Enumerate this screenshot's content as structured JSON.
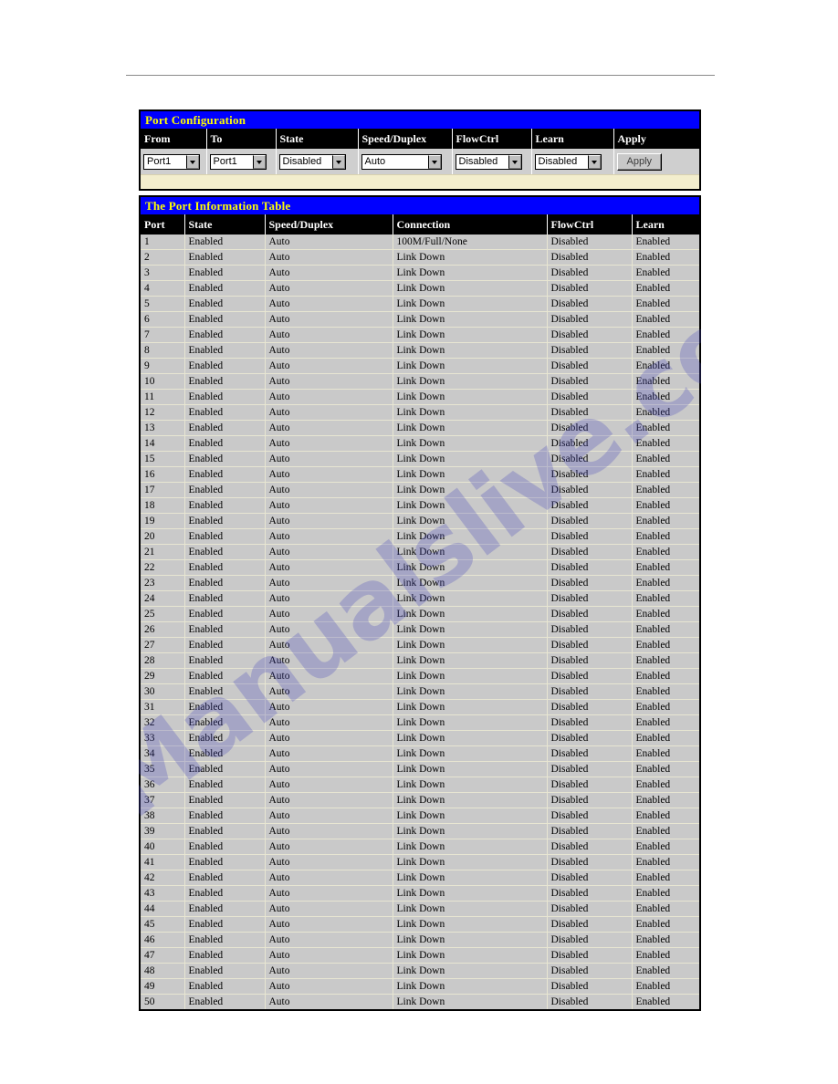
{
  "page": {
    "rule": "horizontal-rule"
  },
  "watermark": {
    "text": "Manualslive.com"
  },
  "port_configuration": {
    "title": "Port Configuration",
    "headers": [
      "From",
      "To",
      "State",
      "Speed/Duplex",
      "FlowCtrl",
      "Learn",
      "Apply"
    ],
    "fields": {
      "from": {
        "label": "From",
        "value": "Port1"
      },
      "to": {
        "label": "To",
        "value": "Port1"
      },
      "state": {
        "label": "State",
        "value": "Disabled"
      },
      "speed_duplex": {
        "label": "Speed/Duplex",
        "value": "Auto"
      },
      "flowctrl": {
        "label": "FlowCtrl",
        "value": "Disabled"
      },
      "learn": {
        "label": "Learn",
        "value": "Disabled"
      }
    },
    "apply_label": "Apply"
  },
  "port_information_table": {
    "title": "The Port Information Table",
    "headers": [
      "Port",
      "State",
      "Speed/Duplex",
      "Connection",
      "FlowCtrl",
      "Learn"
    ],
    "rows": [
      [
        "1",
        "Enabled",
        "Auto",
        "100M/Full/None",
        "Disabled",
        "Enabled"
      ],
      [
        "2",
        "Enabled",
        "Auto",
        "Link Down",
        "Disabled",
        "Enabled"
      ],
      [
        "3",
        "Enabled",
        "Auto",
        "Link Down",
        "Disabled",
        "Enabled"
      ],
      [
        "4",
        "Enabled",
        "Auto",
        "Link Down",
        "Disabled",
        "Enabled"
      ],
      [
        "5",
        "Enabled",
        "Auto",
        "Link Down",
        "Disabled",
        "Enabled"
      ],
      [
        "6",
        "Enabled",
        "Auto",
        "Link Down",
        "Disabled",
        "Enabled"
      ],
      [
        "7",
        "Enabled",
        "Auto",
        "Link Down",
        "Disabled",
        "Enabled"
      ],
      [
        "8",
        "Enabled",
        "Auto",
        "Link Down",
        "Disabled",
        "Enabled"
      ],
      [
        "9",
        "Enabled",
        "Auto",
        "Link Down",
        "Disabled",
        "Enabled"
      ],
      [
        "10",
        "Enabled",
        "Auto",
        "Link Down",
        "Disabled",
        "Enabled"
      ],
      [
        "11",
        "Enabled",
        "Auto",
        "Link Down",
        "Disabled",
        "Enabled"
      ],
      [
        "12",
        "Enabled",
        "Auto",
        "Link Down",
        "Disabled",
        "Enabled"
      ],
      [
        "13",
        "Enabled",
        "Auto",
        "Link Down",
        "Disabled",
        "Enabled"
      ],
      [
        "14",
        "Enabled",
        "Auto",
        "Link Down",
        "Disabled",
        "Enabled"
      ],
      [
        "15",
        "Enabled",
        "Auto",
        "Link Down",
        "Disabled",
        "Enabled"
      ],
      [
        "16",
        "Enabled",
        "Auto",
        "Link Down",
        "Disabled",
        "Enabled"
      ],
      [
        "17",
        "Enabled",
        "Auto",
        "Link Down",
        "Disabled",
        "Enabled"
      ],
      [
        "18",
        "Enabled",
        "Auto",
        "Link Down",
        "Disabled",
        "Enabled"
      ],
      [
        "19",
        "Enabled",
        "Auto",
        "Link Down",
        "Disabled",
        "Enabled"
      ],
      [
        "20",
        "Enabled",
        "Auto",
        "Link Down",
        "Disabled",
        "Enabled"
      ],
      [
        "21",
        "Enabled",
        "Auto",
        "Link Down",
        "Disabled",
        "Enabled"
      ],
      [
        "22",
        "Enabled",
        "Auto",
        "Link Down",
        "Disabled",
        "Enabled"
      ],
      [
        "23",
        "Enabled",
        "Auto",
        "Link Down",
        "Disabled",
        "Enabled"
      ],
      [
        "24",
        "Enabled",
        "Auto",
        "Link Down",
        "Disabled",
        "Enabled"
      ],
      [
        "25",
        "Enabled",
        "Auto",
        "Link Down",
        "Disabled",
        "Enabled"
      ],
      [
        "26",
        "Enabled",
        "Auto",
        "Link Down",
        "Disabled",
        "Enabled"
      ],
      [
        "27",
        "Enabled",
        "Auto",
        "Link Down",
        "Disabled",
        "Enabled"
      ],
      [
        "28",
        "Enabled",
        "Auto",
        "Link Down",
        "Disabled",
        "Enabled"
      ],
      [
        "29",
        "Enabled",
        "Auto",
        "Link Down",
        "Disabled",
        "Enabled"
      ],
      [
        "30",
        "Enabled",
        "Auto",
        "Link Down",
        "Disabled",
        "Enabled"
      ],
      [
        "31",
        "Enabled",
        "Auto",
        "Link Down",
        "Disabled",
        "Enabled"
      ],
      [
        "32",
        "Enabled",
        "Auto",
        "Link Down",
        "Disabled",
        "Enabled"
      ],
      [
        "33",
        "Enabled",
        "Auto",
        "Link Down",
        "Disabled",
        "Enabled"
      ],
      [
        "34",
        "Enabled",
        "Auto",
        "Link Down",
        "Disabled",
        "Enabled"
      ],
      [
        "35",
        "Enabled",
        "Auto",
        "Link Down",
        "Disabled",
        "Enabled"
      ],
      [
        "36",
        "Enabled",
        "Auto",
        "Link Down",
        "Disabled",
        "Enabled"
      ],
      [
        "37",
        "Enabled",
        "Auto",
        "Link Down",
        "Disabled",
        "Enabled"
      ],
      [
        "38",
        "Enabled",
        "Auto",
        "Link Down",
        "Disabled",
        "Enabled"
      ],
      [
        "39",
        "Enabled",
        "Auto",
        "Link Down",
        "Disabled",
        "Enabled"
      ],
      [
        "40",
        "Enabled",
        "Auto",
        "Link Down",
        "Disabled",
        "Enabled"
      ],
      [
        "41",
        "Enabled",
        "Auto",
        "Link Down",
        "Disabled",
        "Enabled"
      ],
      [
        "42",
        "Enabled",
        "Auto",
        "Link Down",
        "Disabled",
        "Enabled"
      ],
      [
        "43",
        "Enabled",
        "Auto",
        "Link Down",
        "Disabled",
        "Enabled"
      ],
      [
        "44",
        "Enabled",
        "Auto",
        "Link Down",
        "Disabled",
        "Enabled"
      ],
      [
        "45",
        "Enabled",
        "Auto",
        "Link Down",
        "Disabled",
        "Enabled"
      ],
      [
        "46",
        "Enabled",
        "Auto",
        "Link Down",
        "Disabled",
        "Enabled"
      ],
      [
        "47",
        "Enabled",
        "Auto",
        "Link Down",
        "Disabled",
        "Enabled"
      ],
      [
        "48",
        "Enabled",
        "Auto",
        "Link Down",
        "Disabled",
        "Enabled"
      ],
      [
        "49",
        "Enabled",
        "Auto",
        "Link Down",
        "Disabled",
        "Enabled"
      ],
      [
        "50",
        "Enabled",
        "Auto",
        "Link Down",
        "Disabled",
        "Enabled"
      ]
    ]
  },
  "colors": {
    "title_bar": "#0000ff",
    "title_text": "#ffff00",
    "header_bar": "#000000",
    "cell_bg": "#c9c9c9",
    "cream": "#f3eecd"
  }
}
